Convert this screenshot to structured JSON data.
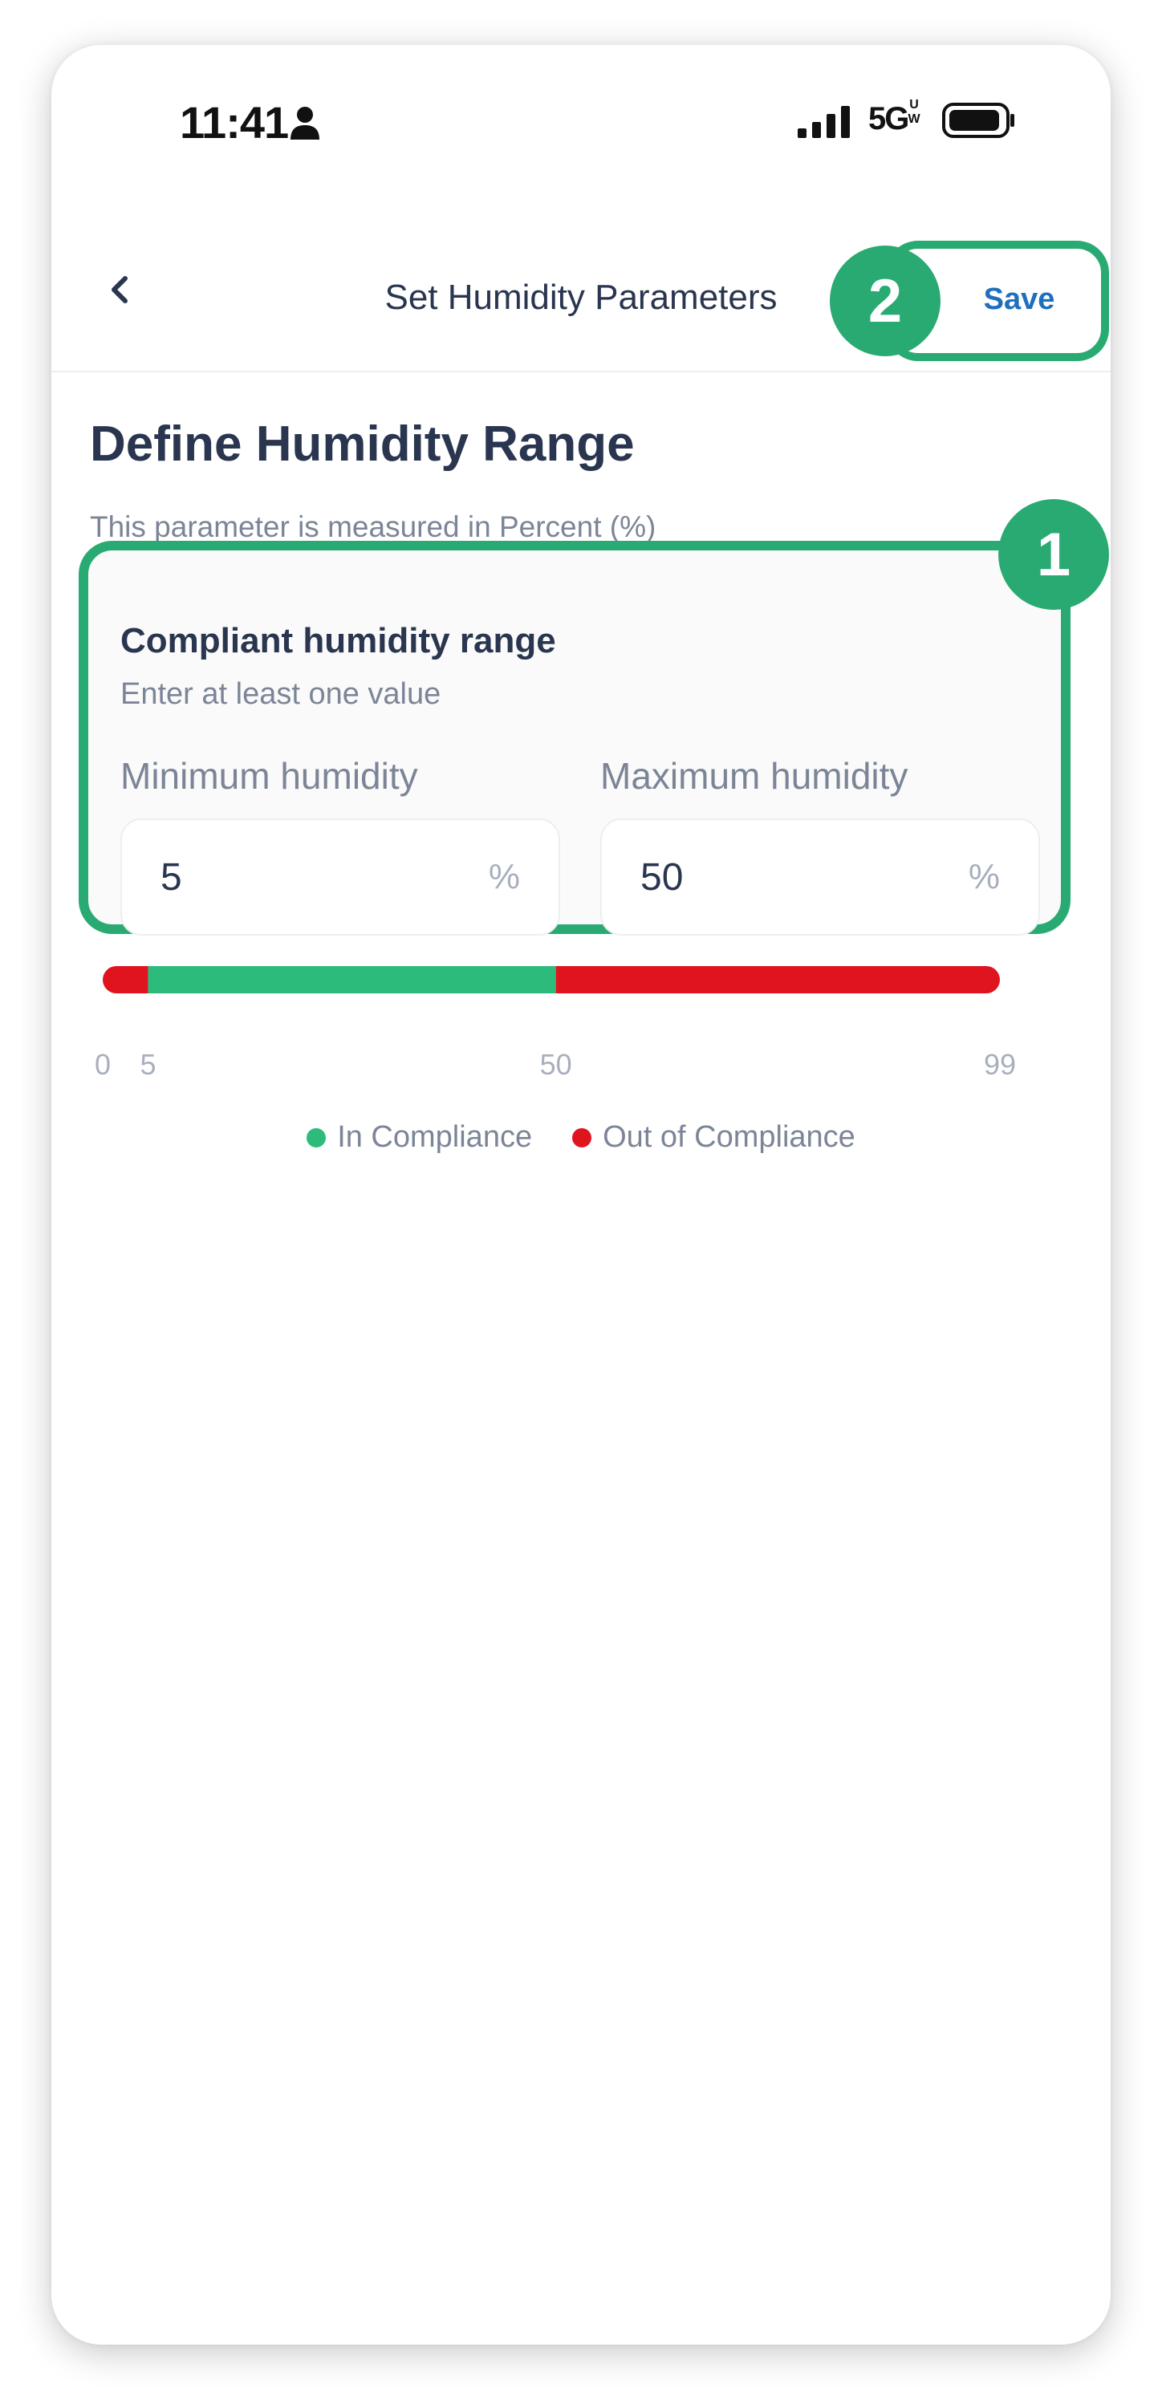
{
  "status_bar": {
    "time": "11:41",
    "network": "5G",
    "network_sup": "UW"
  },
  "header": {
    "title": "Set Humidity Parameters",
    "save_label": "Save",
    "back_icon": "chevron-left-icon"
  },
  "annotations": {
    "badge_1": "1",
    "badge_2": "2"
  },
  "section": {
    "title": "Define Humidity Range",
    "subtitle": "This parameter is measured in Percent (%)"
  },
  "range_card": {
    "title": "Compliant humidity range",
    "hint": "Enter at least one value",
    "min": {
      "label": "Minimum humidity",
      "value": "5",
      "unit": "%"
    },
    "max": {
      "label": "Maximum humidity",
      "value": "50",
      "unit": "%"
    }
  },
  "compliance_bar": {
    "scale_min": 0,
    "scale_max": 99,
    "compliant_from": 5,
    "compliant_to": 50,
    "ticks": [
      "0",
      "5",
      "50",
      "99"
    ],
    "colors": {
      "in": "#2dbb7c",
      "out": "#e0141e"
    }
  },
  "legend": {
    "in_compliance": "In Compliance",
    "out_of_compliance": "Out of Compliance"
  }
}
